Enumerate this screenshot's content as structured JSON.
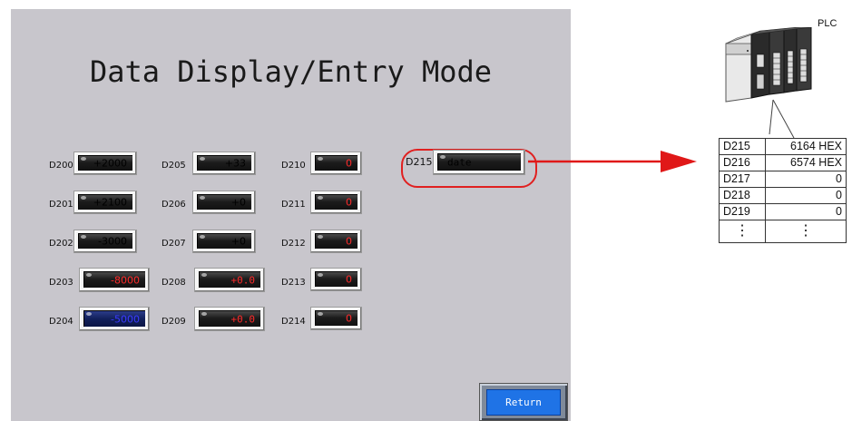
{
  "screen": {
    "title": "Data Display/Entry Mode",
    "return_label": "Return"
  },
  "registers": [
    {
      "label": "D200",
      "value": "+2000",
      "color": "#ffffff",
      "style": "dark"
    },
    {
      "label": "D201",
      "value": "+2100",
      "color": "#ffffff",
      "style": "dark"
    },
    {
      "label": "D202",
      "value": "-3000",
      "color": "#ffffff",
      "style": "dark"
    },
    {
      "label": "D203",
      "value": "-8000",
      "color": "#ff2a2a",
      "style": "dark"
    },
    {
      "label": "D204",
      "value": "-5000",
      "color": "#2b2bff",
      "style": "blue"
    },
    {
      "label": "D205",
      "value": "+33",
      "color": "#ffffff",
      "style": "dark"
    },
    {
      "label": "D206",
      "value": "+0",
      "color": "#ffffff",
      "style": "dark"
    },
    {
      "label": "D207",
      "value": "+0",
      "color": "#ffffff",
      "style": "dark"
    },
    {
      "label": "D208",
      "value": "+0.0",
      "color": "#ff2a2a",
      "style": "dark"
    },
    {
      "label": "D209",
      "value": "+0.0",
      "color": "#ff2a2a",
      "style": "dark"
    },
    {
      "label": "D210",
      "value": "0",
      "color": "#ff2a2a",
      "style": "dark"
    },
    {
      "label": "D211",
      "value": "0",
      "color": "#ff2a2a",
      "style": "dark"
    },
    {
      "label": "D212",
      "value": "0",
      "color": "#ff2a2a",
      "style": "dark"
    },
    {
      "label": "D213",
      "value": "0",
      "color": "#ff2a2a",
      "style": "dark"
    },
    {
      "label": "D214",
      "value": "0",
      "color": "#ff2a2a",
      "style": "dark"
    },
    {
      "label": "D215",
      "value": "date",
      "color": "#ffffff",
      "style": "dark"
    }
  ],
  "plc": {
    "label": "PLC",
    "rows": [
      {
        "addr": "D215",
        "value": "6164 HEX"
      },
      {
        "addr": "D216",
        "value": "6574 HEX"
      },
      {
        "addr": "D217",
        "value": "0"
      },
      {
        "addr": "D218",
        "value": "0"
      },
      {
        "addr": "D219",
        "value": "0"
      },
      {
        "addr": "⋮",
        "value": "⋮"
      }
    ]
  },
  "colors": {
    "panel": "#c8c6cc",
    "highlight": "#e02020",
    "return_button": "#1f73e6"
  }
}
